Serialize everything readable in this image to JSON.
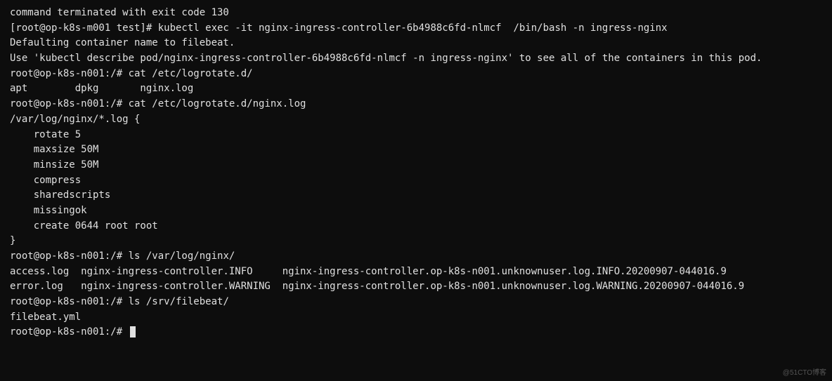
{
  "lines": {
    "l0": "command terminated with exit code 130",
    "l1p": "[root@op-k8s-m001 test]# ",
    "l1c": "kubectl exec -it nginx-ingress-controller-6b4988c6fd-nlmcf  /bin/bash -n ingress-nginx",
    "l2": "Defaulting container name to filebeat.",
    "l3": "Use 'kubectl describe pod/nginx-ingress-controller-6b4988c6fd-nlmcf -n ingress-nginx' to see all of the containers in this pod.",
    "l4p": "root@op-k8s-n001:/# ",
    "l4c": "cat /etc/logrotate.d/",
    "l5": "apt        dpkg       nginx.log",
    "l6p": "root@op-k8s-n001:/# ",
    "l6c": "cat /etc/logrotate.d/nginx.log",
    "l7": "/var/log/nginx/*.log {",
    "l8": "    rotate 5",
    "l9": "    maxsize 50M",
    "l10": "    minsize 50M",
    "l11": "    compress",
    "l12": "    sharedscripts",
    "l13": "    missingok",
    "l14": "    create 0644 root root",
    "l15": "}",
    "l16p": "root@op-k8s-n001:/# ",
    "l16c": "ls /var/log/nginx/",
    "l17": "access.log  nginx-ingress-controller.INFO     nginx-ingress-controller.op-k8s-n001.unknownuser.log.INFO.20200907-044016.9",
    "l18": "error.log   nginx-ingress-controller.WARNING  nginx-ingress-controller.op-k8s-n001.unknownuser.log.WARNING.20200907-044016.9",
    "l19p": "root@op-k8s-n001:/# ",
    "l19c": "ls /srv/filebeat/",
    "l20": "filebeat.yml",
    "l21p": "root@op-k8s-n001:/# "
  },
  "watermark": "@51CTO博客"
}
